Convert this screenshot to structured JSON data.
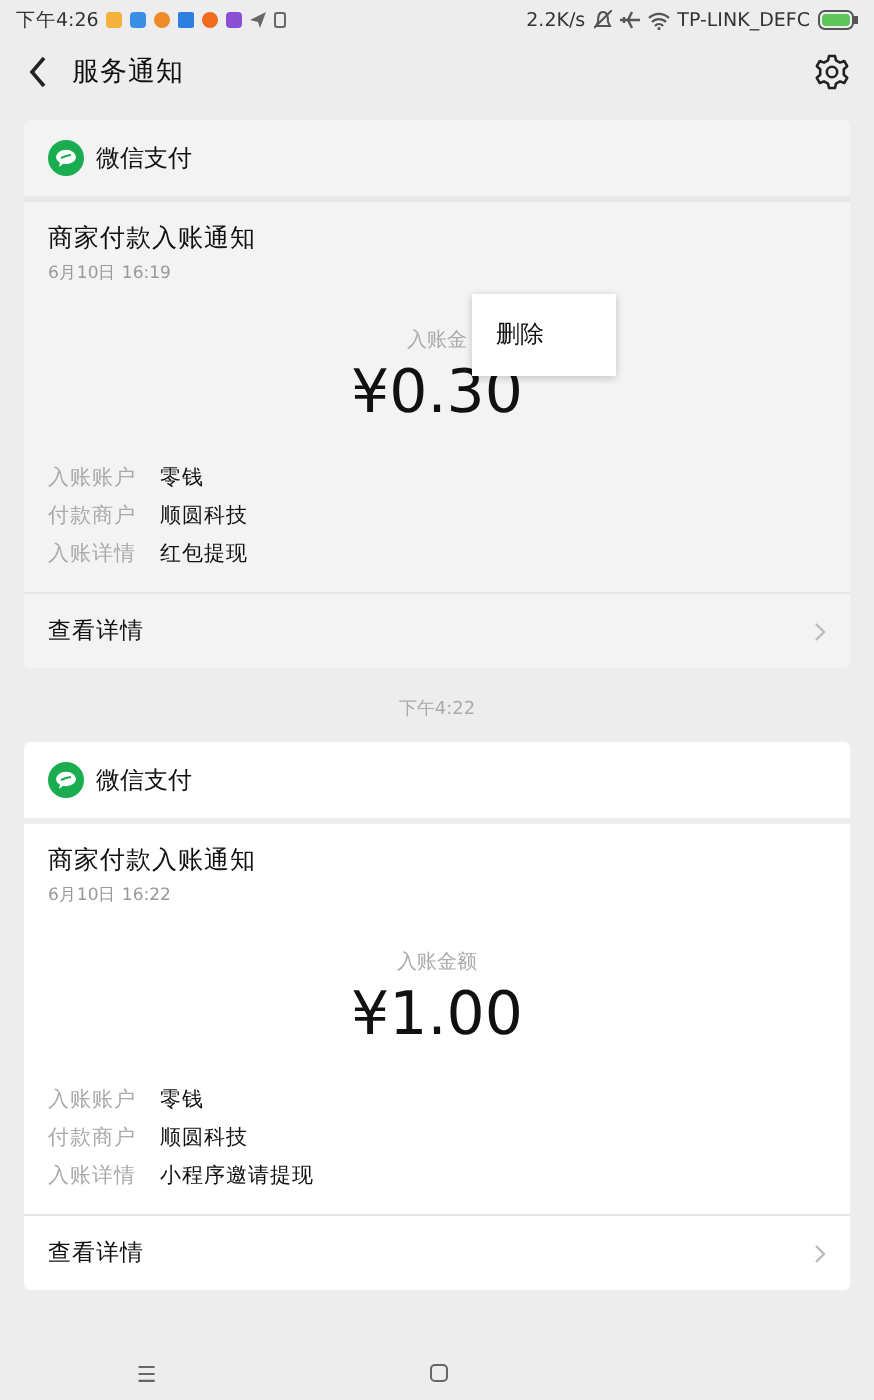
{
  "status_bar": {
    "time": "下午4:26",
    "speed": "2.2K/s",
    "network": "TP-LINK_DEFC"
  },
  "header": {
    "title": "服务通知"
  },
  "messages": [
    {
      "source": "微信支付",
      "title": "商家付款入账通知",
      "date": "6月10日 16:19",
      "amount_label": "入账金",
      "amount": "¥0.30",
      "highlighted": true,
      "fields": [
        {
          "label": "入账账户",
          "value": "零钱"
        },
        {
          "label": "付款商户",
          "value": "顺圆科技"
        },
        {
          "label": "入账详情",
          "value": "红包提现"
        }
      ],
      "link": "查看详情"
    },
    {
      "timestamp": "下午4:22",
      "source": "微信支付",
      "title": "商家付款入账通知",
      "date": "6月10日 16:22",
      "amount_label": "入账金额",
      "amount": "¥1.00",
      "highlighted": false,
      "fields": [
        {
          "label": "入账账户",
          "value": "零钱"
        },
        {
          "label": "付款商户",
          "value": "顺圆科技"
        },
        {
          "label": "入账详情",
          "value": "小程序邀请提现"
        }
      ],
      "link": "查看详情"
    }
  ],
  "context_menu": {
    "items": [
      "删除"
    ]
  },
  "nav_bar": {
    "menu": "☰"
  }
}
